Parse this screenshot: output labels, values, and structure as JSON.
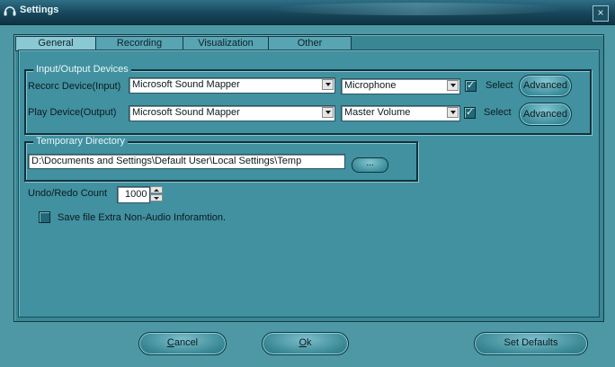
{
  "window": {
    "title": "Settings",
    "close_glyph": "×"
  },
  "tabs": [
    {
      "label": "General",
      "active": true
    },
    {
      "label": "Recording",
      "active": false
    },
    {
      "label": "Visualization",
      "active": false
    },
    {
      "label": "Other",
      "active": false
    }
  ],
  "io_devices": {
    "group_title": "Input/Output Devices",
    "record_label": "Recorc Device(Input)",
    "record_device": "Microsoft Sound Mapper",
    "record_line": "Microphone",
    "record_select_label": "Select",
    "record_select_checked": true,
    "record_advanced": "Advanced",
    "play_label": "Play Device(Output)",
    "play_device": "Microsoft Sound Mapper",
    "play_line": "Master Volume",
    "play_select_label": "Select",
    "play_select_checked": true,
    "play_advanced": "Advanced"
  },
  "temp_dir": {
    "group_title": "Temporary Directory",
    "path": "D:\\Documents and Settings\\Default User\\Local Settings\\Temp",
    "browse_label": "..."
  },
  "undo": {
    "label": "Undo/Redo Count",
    "value": "1000"
  },
  "extra_info": {
    "label": "Save file Extra Non-Audio Inforamtion.",
    "checked": false
  },
  "buttons": {
    "cancel_first": "C",
    "cancel_rest": "ancel",
    "ok_first": "O",
    "ok_rest": "k",
    "defaults": "Set Defaults"
  },
  "colors": {
    "background": "#4d98a4",
    "titlebar": "#17465a",
    "panel": "#3a8693"
  },
  "icons": {
    "app_icon": "headphones-icon",
    "close": "close-icon"
  }
}
